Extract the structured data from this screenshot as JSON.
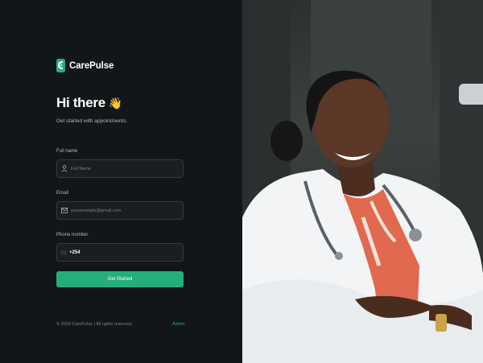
{
  "brand": {
    "name": "CarePulse",
    "accent": "#24ae7c"
  },
  "heading": {
    "title": "Hi there",
    "emoji": "👋",
    "subtitle": "Get started with appointments."
  },
  "form": {
    "full_name": {
      "label": "Full name",
      "placeholder": "Full Name",
      "icon": "user-icon"
    },
    "email": {
      "label": "Email",
      "placeholder": "yourexample@gmail.com",
      "icon": "email-icon"
    },
    "phone": {
      "label": "Phone number",
      "value": "+254",
      "icon": "flag-icon"
    },
    "submit_label": "Get Started"
  },
  "footer": {
    "copyright": "© 2024 CarePulse | All rights reserved.",
    "admin_link": "Admin"
  },
  "hero": {
    "image": "doctor-photo"
  }
}
